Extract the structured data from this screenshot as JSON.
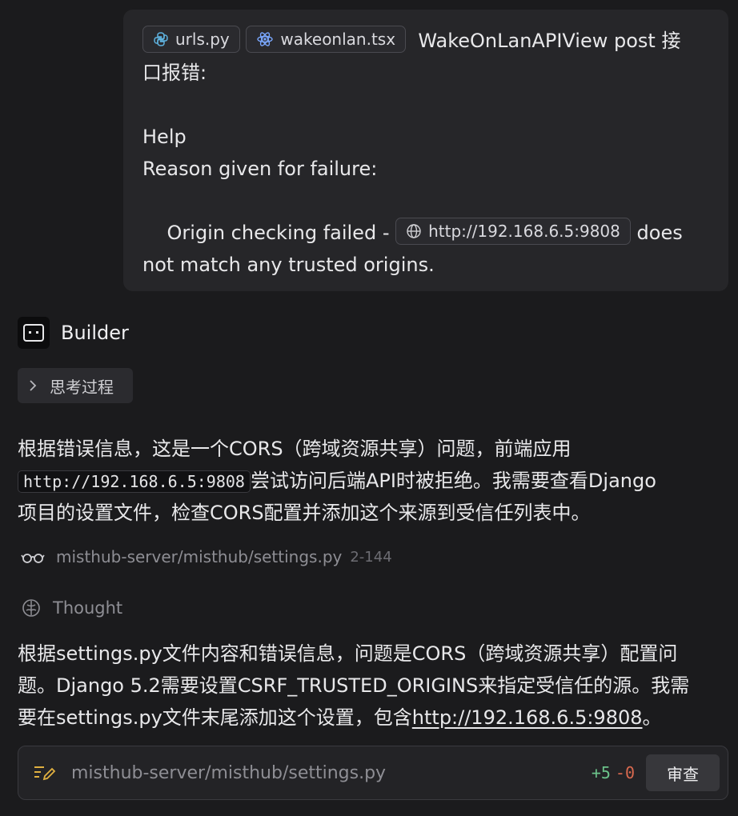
{
  "user_message": {
    "chips": [
      {
        "label": "urls.py",
        "icon": "python-icon"
      },
      {
        "label": "wakeonlan.tsx",
        "icon": "react-icon"
      }
    ],
    "line1_text": "WakeOnLanAPIView post 接",
    "line2_text": "口报错:",
    "line4_text": "Help",
    "line5_text": "Reason given for failure:",
    "line7_prefix": "    Origin checking failed - ",
    "url_chip": "http://192.168.6.5:9808",
    "line7_suffix": "does",
    "line8_text": "not match any trusted origins."
  },
  "agent": {
    "name": "Builder",
    "thinking_label": "思考过程"
  },
  "response1": {
    "line1": "根据错误信息，这是一个CORS（跨域资源共享）问题，前端应用",
    "code": "http://192.168.6.5:9808",
    "line2_suffix": "尝试访问后端API时被拒绝。我需要查看Django",
    "line3": "项目的设置文件，检查CORS配置并添加这个来源到受信任列表中。"
  },
  "file_ref": {
    "path": "misthub-server/misthub/settings.py",
    "range": "2-144"
  },
  "thought_label": "Thought",
  "response2": {
    "line1": "根据settings.py文件内容和错误信息，问题是CORS（跨域资源共享）配置问",
    "line2": "题。Django 5.2需要设置CSRF_TRUSTED_ORIGINS来指定受信任的源。我需",
    "line3_prefix": "要在settings.py文件末尾添加这个设置，包含",
    "line3_link": "http://192.168.6.5:9808",
    "line3_suffix": "。"
  },
  "edit_bar": {
    "path": "misthub-server/misthub/settings.py",
    "additions": "+5",
    "deletions": "-0",
    "review_label": "审查"
  },
  "colors": {
    "background": "#1b1b1d",
    "bubble": "#262629",
    "additions": "#6bc28a",
    "deletions": "#d9694f",
    "python_icon": "#5fb3e0",
    "react_icon": "#7aa8ff"
  }
}
